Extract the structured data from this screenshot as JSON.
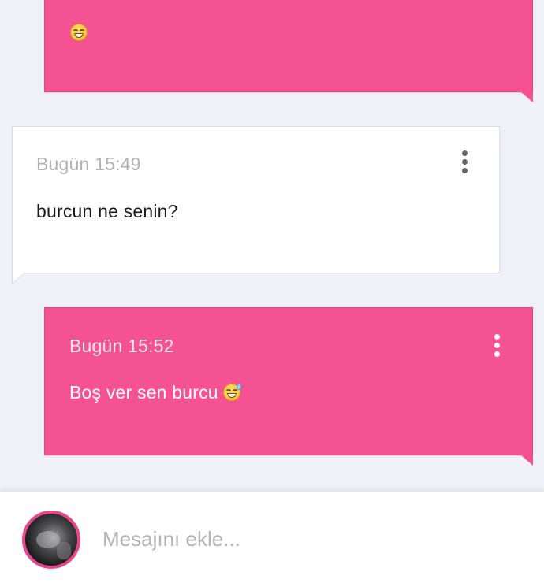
{
  "messages": [
    {
      "direction": "sent",
      "time": "",
      "text": "",
      "emoji": "grinning-face-icon"
    },
    {
      "direction": "received",
      "time": "Bugün 15:49",
      "text": "burcun ne senin?"
    },
    {
      "direction": "sent",
      "time": "Bugün 15:52",
      "text": "Boş ver sen burcu",
      "emoji": "grinning-sweat-face-icon"
    }
  ],
  "composer": {
    "placeholder": "Mesajını ekle...",
    "value": ""
  },
  "colors": {
    "sent_bubble": "#f55293",
    "received_bubble": "#ffffff",
    "background": "#f0f1f8",
    "avatar_ring": "#e8468a"
  }
}
